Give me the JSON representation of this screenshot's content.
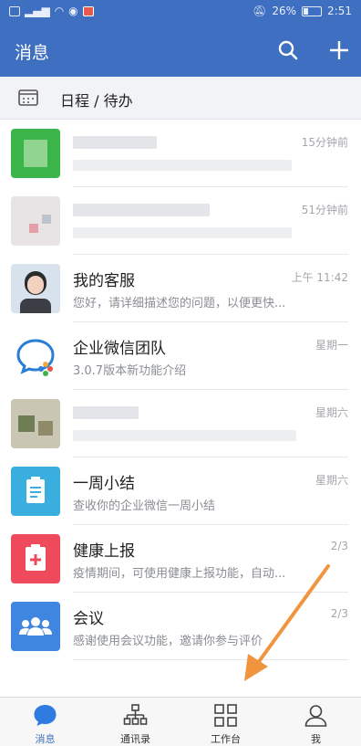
{
  "status_bar": {
    "battery": "26%",
    "time": "2:51"
  },
  "header": {
    "title": "消息"
  },
  "schedule": {
    "label": "日程 / 待办"
  },
  "conversations": [
    {
      "title": "",
      "subtitle": "",
      "time": "15分钟前",
      "blurred": true
    },
    {
      "title": "",
      "subtitle": "",
      "time": "51分钟前",
      "blurred": true
    },
    {
      "title": "我的客服",
      "subtitle": "您好，请详细描述您的问题，以便更快...",
      "time": "上午 11:42"
    },
    {
      "title": "企业微信团队",
      "subtitle": "3.0.7版本新功能介绍",
      "time": "星期一"
    },
    {
      "title": "",
      "subtitle": "",
      "time": "星期六",
      "blurred": true
    },
    {
      "title": "一周小结",
      "subtitle": "查收你的企业微信一周小结",
      "time": "星期六"
    },
    {
      "title": "健康上报",
      "subtitle": "疫情期间，可使用健康上报功能，自动...",
      "time": "2/3"
    },
    {
      "title": "会议",
      "subtitle": "感谢使用会议功能，邀请你参与评价",
      "time": "2/3"
    }
  ],
  "tabs": [
    {
      "label": "消息",
      "icon": "chat-bubble-icon",
      "active": true
    },
    {
      "label": "通讯录",
      "icon": "org-chart-icon"
    },
    {
      "label": "工作台",
      "icon": "grid-icon"
    },
    {
      "label": "我",
      "icon": "person-icon"
    }
  ],
  "colors": {
    "primary": "#3f6fc0",
    "annotation_arrow": "#f0953e"
  }
}
